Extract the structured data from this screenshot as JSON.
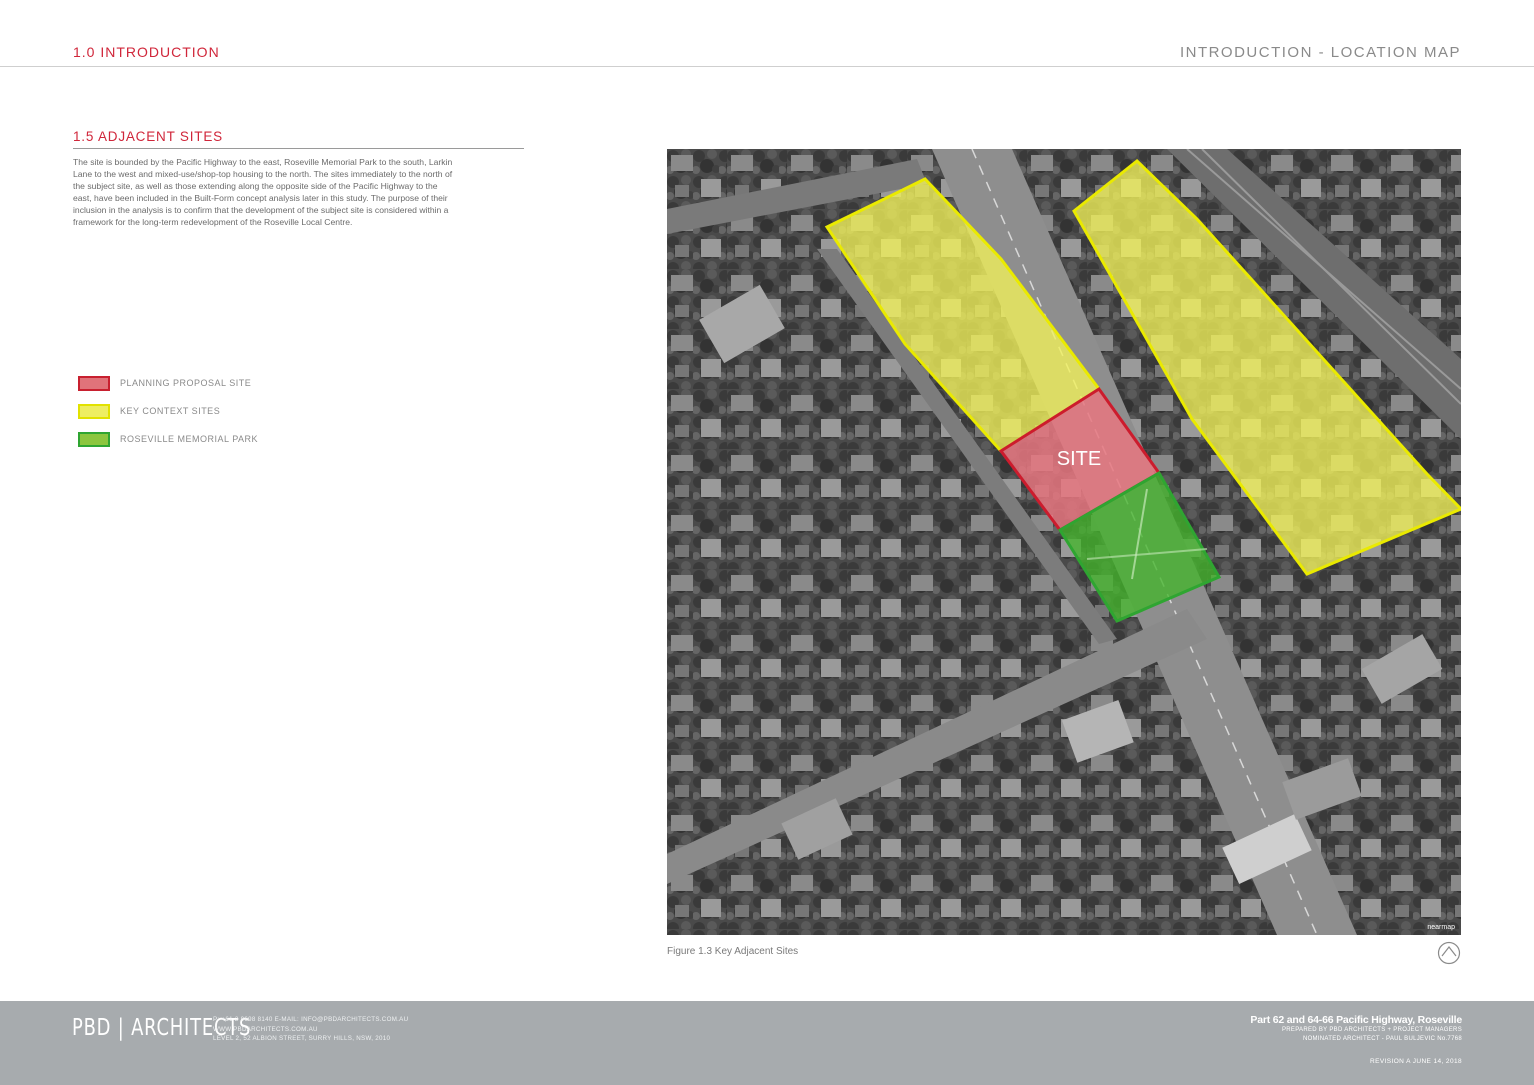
{
  "header": {
    "section": "1.0 INTRODUCTION",
    "title": "INTRODUCTION - LOCATION MAP"
  },
  "section": {
    "title": "1.5 ADJACENT SITES",
    "body": "The site is bounded by the Pacific Highway to the east, Roseville Memorial Park to the south, Larkin Lane to the west and mixed-use/shop-top housing to the north. The sites immediately to the north of the subject site, as well as those extending along the opposite side of the Pacific Highway to the east, have been included in the Built-Form concept analysis later in this study. The purpose of their inclusion in the analysis is to confirm that the development of the subject site is considered within a framework for the long-term redevelopment of the Roseville Local Centre."
  },
  "legend": [
    {
      "label": "PLANNING PROPOSAL SITE",
      "fill": "#e0737a",
      "border": "#c8202f"
    },
    {
      "label": "KEY CONTEXT SITES",
      "fill": "#eeee62",
      "border": "#e2e200"
    },
    {
      "label": "ROSEVILLE MEMORIAL PARK",
      "fill": "#8cc63e",
      "border": "#2fa531"
    }
  ],
  "map": {
    "site_label": "SITE",
    "watermark": "nearmap",
    "caption": "Figure 1.3 Key Adjacent Sites"
  },
  "footer": {
    "logo": "PBD | ARCHITECTS",
    "contact_line1": "P: +61 2 9698 8140     E-MAIL: INFO@PBDARCHITECTS.COM.AU",
    "contact_line2": "WWW.PBDARCHITECTS.COM.AU",
    "contact_line3": "LEVEL 2, 52 ALBION STREET, SURRY HILLS, NSW, 2010",
    "project_title": "Part 62 and 64-66 Pacific Highway, Roseville",
    "prepared_by": "PREPARED BY PBD ARCHITECTS + PROJECT MANAGERS",
    "architect": "NOMINATED ARCHITECT - PAUL BULJEVIC   No.7768",
    "revision": "REVISION A     JUNE 14, 2018"
  }
}
